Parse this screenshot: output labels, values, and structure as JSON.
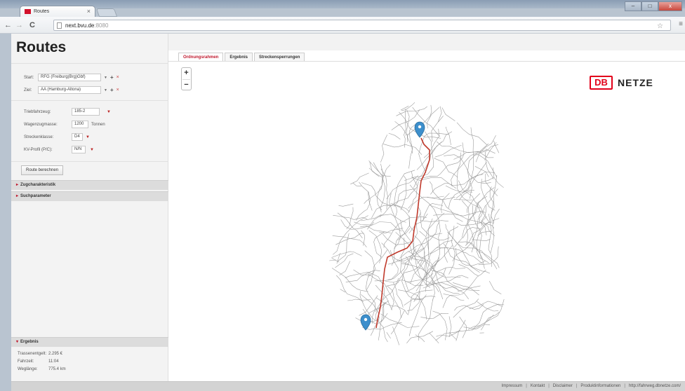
{
  "browser": {
    "tab_title": "Routes",
    "tab_close": "×",
    "url_host": "next.bvu.de",
    "url_port": ":8080",
    "back": "←",
    "forward": "→",
    "reload": "C",
    "star": "☆",
    "menu": "≡",
    "win_min": "–",
    "win_max": "□",
    "win_close": "x"
  },
  "sidebar": {
    "title": "Routes",
    "start_label": "Start:",
    "start_value": "RFG (Freiburg(Brg)Gbf)",
    "ziel_label": "Ziel:",
    "ziel_value": "AA (Hamburg-Altona)",
    "plus": "+",
    "x": "×",
    "tri": "▼",
    "params": [
      {
        "label": "Triebfahrzeug:",
        "value": "185-2"
      },
      {
        "label": "Wagenzugmasse:",
        "value": "1200",
        "unit": "Tonnen"
      },
      {
        "label": "Streckenklasse:",
        "value": "D4"
      },
      {
        "label": "KV-Profil (P/C):",
        "value": "N/N"
      }
    ],
    "calc_button": "Route berechnen",
    "acc1": "Zugcharakteristik",
    "acc2": "Suchparameter",
    "acc3": "Ergebnis",
    "acc_arrow": "▸",
    "acc_arrow_open": "▾",
    "result": [
      {
        "label": "Trassenentgelt:",
        "value": "2.295 €"
      },
      {
        "label": "Fahrzeit:",
        "value": "11:04"
      },
      {
        "label": "Weglänge:",
        "value": "775.4 km"
      }
    ]
  },
  "main": {
    "tabs": [
      "Ordnungsrahmen",
      "Ergebnis",
      "Streckensperrungen"
    ],
    "zoom_in": "+",
    "zoom_out": "−",
    "logo_db": "DB",
    "logo_netze": "NETZE"
  },
  "footer": {
    "links": [
      "Impressum",
      "Kontakt",
      "Disclaimer",
      "Produktinformationen",
      "http://fahrweg.dbnetze.com/"
    ],
    "sep": "|"
  },
  "colors": {
    "route": "#c0392b",
    "marker": "#3d8fcc",
    "accent": "#c0182d",
    "db_red": "#e2001a"
  }
}
